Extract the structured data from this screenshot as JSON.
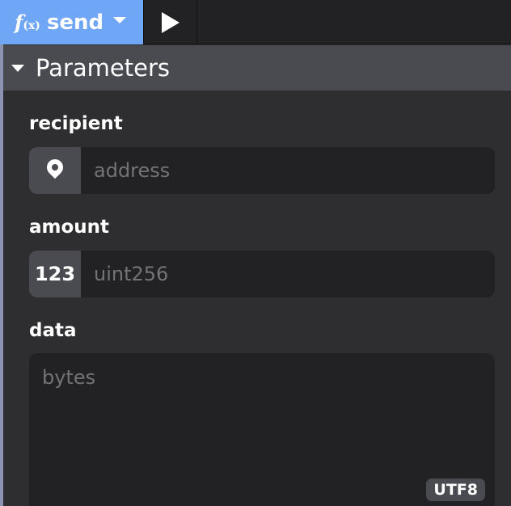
{
  "toolbar": {
    "function_icon_main": "f",
    "function_icon_sub": "(x)",
    "function_name": "send",
    "dropdown_icon": "chevron-down-icon",
    "run_icon": "play-icon"
  },
  "section": {
    "collapse_icon": "triangle-down-icon",
    "title": "Parameters"
  },
  "params": [
    {
      "label": "recipient",
      "prefix_icon": "location-pin-icon",
      "placeholder": "address"
    },
    {
      "label": "amount",
      "prefix_text": "123",
      "placeholder": "uint256"
    },
    {
      "label": "data",
      "placeholder": "bytes",
      "encoding": "UTF8"
    }
  ],
  "colors": {
    "accent": "#6fa6f5",
    "background": "#2e2e30",
    "header": "#4a4b50",
    "input": "#222224",
    "placeholder": "#737478"
  }
}
